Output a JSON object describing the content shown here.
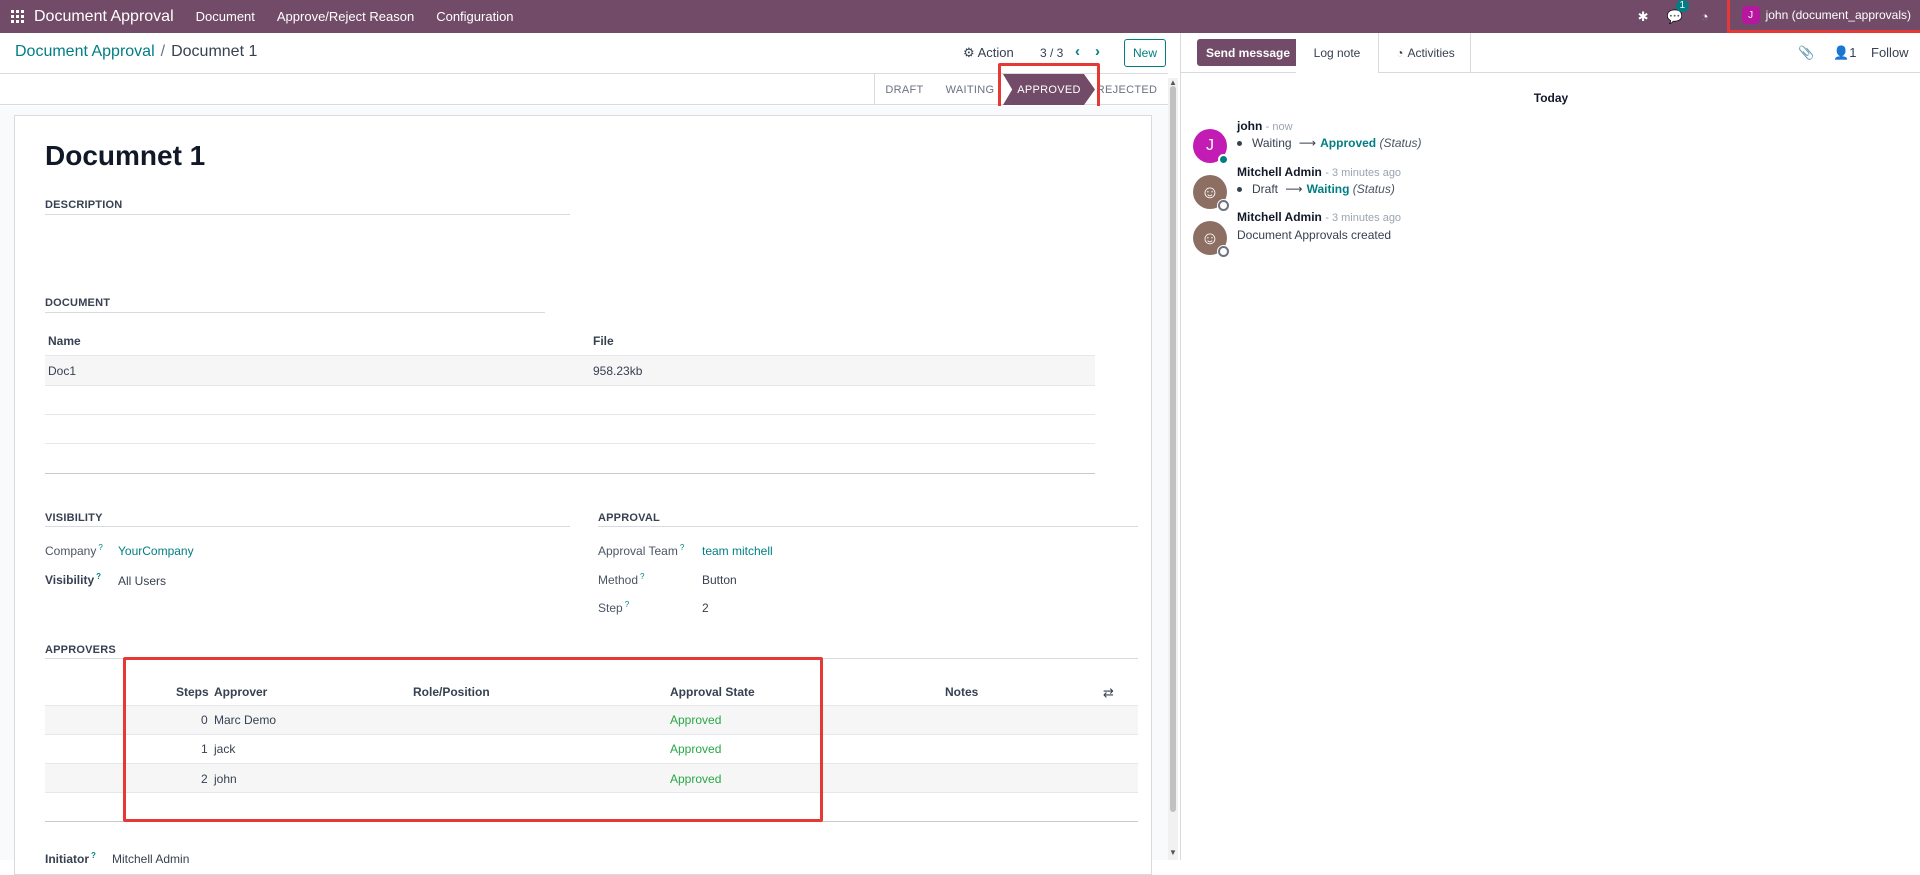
{
  "navbar": {
    "brand": "Document Approval",
    "menu": [
      "Document",
      "Approve/Reject Reason",
      "Configuration"
    ],
    "chat_badge": "1",
    "user_initial": "J",
    "user_name": "john (document_approvals)"
  },
  "control": {
    "breadcrumb_parent": "Document Approval",
    "breadcrumb_sep": "/",
    "breadcrumb_current": "Documnet 1",
    "action_label": "Action",
    "pager": "3 / 3",
    "new_label": "New"
  },
  "statusbar": {
    "stages": [
      "DRAFT",
      "WAITING",
      "APPROVED",
      "REJECTED"
    ],
    "active": "APPROVED"
  },
  "form": {
    "title": "Documnet 1",
    "description_label": "DESCRIPTION",
    "document_label": "DOCUMENT",
    "document_table": {
      "headers": [
        "Name",
        "File"
      ],
      "rows": [
        [
          "Doc1",
          "958.23kb"
        ]
      ]
    },
    "visibility_label": "VISIBILITY",
    "company_label": "Company",
    "company_value": "YourCompany",
    "visibility_field_label": "Visibility",
    "visibility_value": "All Users",
    "approval_label": "APPROVAL",
    "team_label": "Approval Team",
    "team_value": "team mitchell",
    "method_label": "Method",
    "method_value": "Button",
    "step_label": "Step",
    "step_value": "2",
    "approvers_label": "APPROVERS",
    "approvers_table": {
      "headers": [
        "Steps",
        "Approver",
        "Role/Position",
        "Approval State",
        "Notes"
      ],
      "rows": [
        [
          "0",
          "Marc Demo",
          "",
          "Approved",
          ""
        ],
        [
          "1",
          "jack",
          "",
          "Approved",
          ""
        ],
        [
          "2",
          "john",
          "",
          "Approved",
          ""
        ]
      ]
    },
    "initiator_label": "Initiator",
    "initiator_value": "Mitchell Admin",
    "help_mark": "?"
  },
  "chatter": {
    "send_message": "Send message",
    "log_note": "Log note",
    "activities": "Activities",
    "attachments_icon": "paperclip-icon",
    "followers_count": "1",
    "follow": "Follow",
    "today": "Today",
    "messages": [
      {
        "author": "john",
        "time": "- now",
        "initial": "J",
        "old": "Waiting",
        "new": "Approved",
        "field": "(Status)"
      },
      {
        "author": "Mitchell Admin",
        "time": "- 3 minutes ago",
        "old": "Draft",
        "new": "Waiting",
        "field": "(Status)"
      },
      {
        "author": "Mitchell Admin",
        "time": "- 3 minutes ago",
        "body": "Document Approvals created"
      }
    ]
  },
  "colors": {
    "brand": "#714b67",
    "link": "#017e84",
    "approved": "#28a745",
    "highlight": "#e53935"
  }
}
